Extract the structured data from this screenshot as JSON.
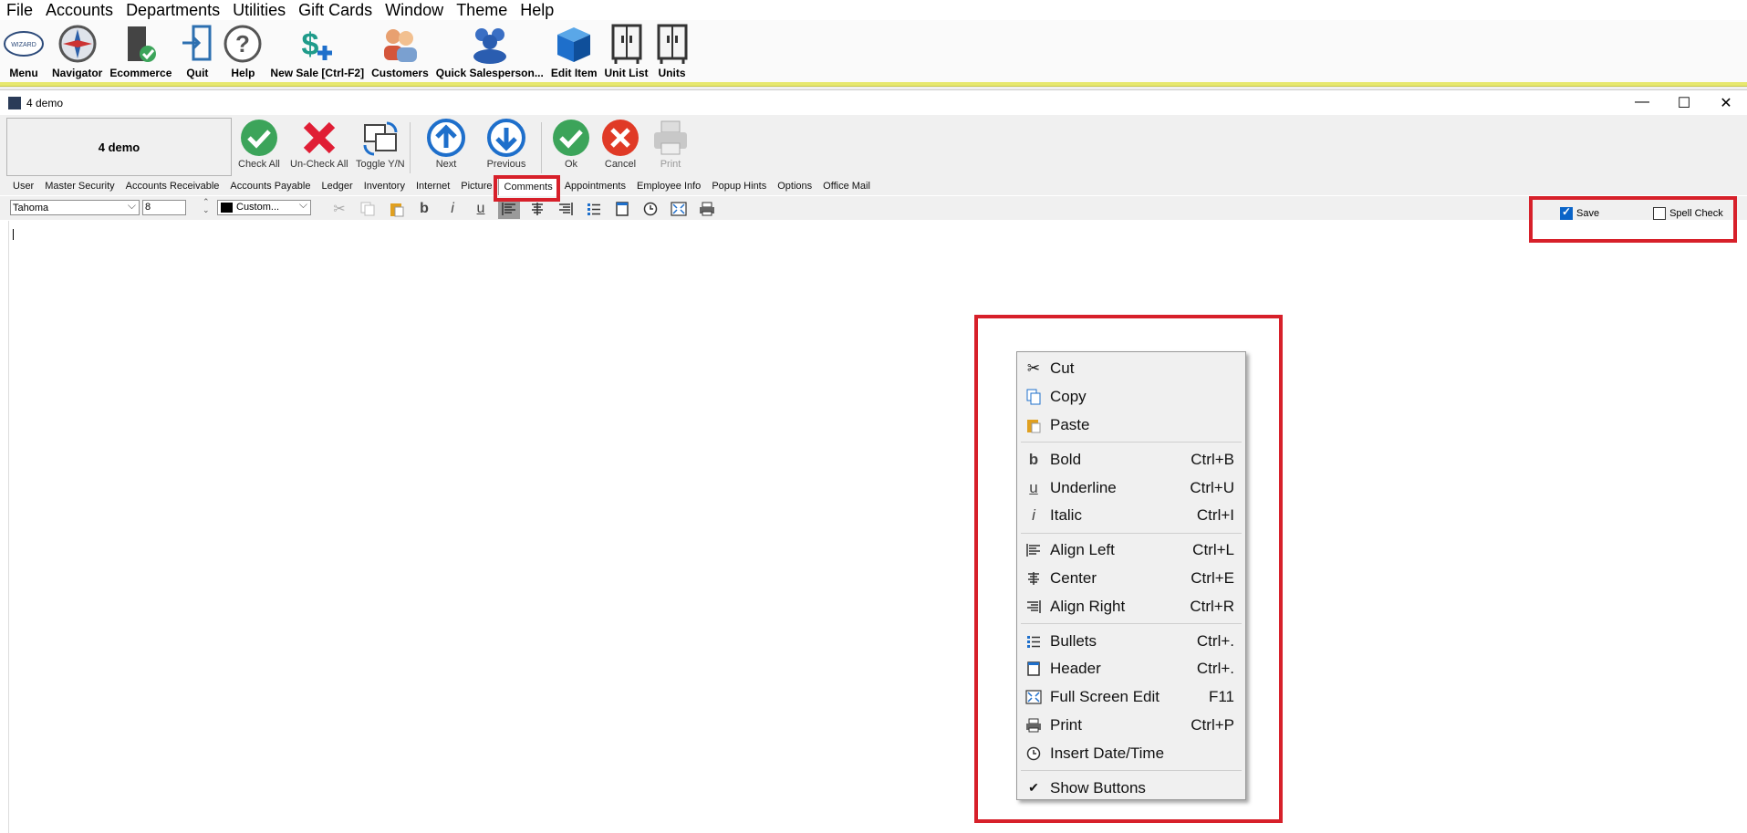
{
  "menubar": [
    "File",
    "Accounts",
    "Departments",
    "Utilities",
    "Gift Cards",
    "Window",
    "Theme",
    "Help"
  ],
  "apptoolbar": [
    "Menu",
    "Navigator",
    "Ecommerce",
    "Quit",
    "Help",
    "New Sale [Ctrl-F2]",
    "Customers",
    "Quick Salesperson...",
    "Edit Item",
    "Unit List",
    "Units"
  ],
  "window": {
    "title": "4 demo",
    "name_display": "4 demo",
    "minimize": "—",
    "maximize": "☐",
    "close": "✕"
  },
  "formtoolbar": {
    "check_all": "Check All",
    "uncheck_all": "Un-Check All",
    "toggle": "Toggle Y/N",
    "next": "Next",
    "previous": "Previous",
    "ok": "Ok",
    "cancel": "Cancel",
    "print": "Print"
  },
  "tabs": [
    "User",
    "Master Security",
    "Accounts Receivable",
    "Accounts Payable",
    "Ledger",
    "Inventory",
    "Internet",
    "Picture",
    "Comments",
    "Appointments",
    "Employee Info",
    "Popup Hints",
    "Options",
    "Office Mail"
  ],
  "active_tab": "Comments",
  "format": {
    "font": "Tahoma",
    "size": "8",
    "color": "Custom..."
  },
  "options": {
    "save_label": "Save",
    "save_checked": true,
    "spell_label": "Spell Check",
    "spell_checked": false
  },
  "context_menu": {
    "cut": "Cut",
    "copy": "Copy",
    "paste": "Paste",
    "bold": "Bold",
    "bold_sc": "Ctrl+B",
    "underline": "Underline",
    "underline_sc": "Ctrl+U",
    "italic": "Italic",
    "italic_sc": "Ctrl+I",
    "align_left": "Align Left",
    "align_left_sc": "Ctrl+L",
    "center": "Center",
    "center_sc": "Ctrl+E",
    "align_right": "Align Right",
    "align_right_sc": "Ctrl+R",
    "bullets": "Bullets",
    "bullets_sc": "Ctrl+.",
    "header": "Header",
    "header_sc": "Ctrl+.",
    "fullscreen": "Full Screen Edit",
    "fullscreen_sc": "F11",
    "print": "Print",
    "print_sc": "Ctrl+P",
    "insert_date": "Insert Date/Time",
    "show_buttons": "Show Buttons"
  },
  "colors": {
    "highlight": "#d7202a",
    "check": "#3ca45a",
    "cross": "#e01e35",
    "nav_blue": "#1e6fcb"
  }
}
